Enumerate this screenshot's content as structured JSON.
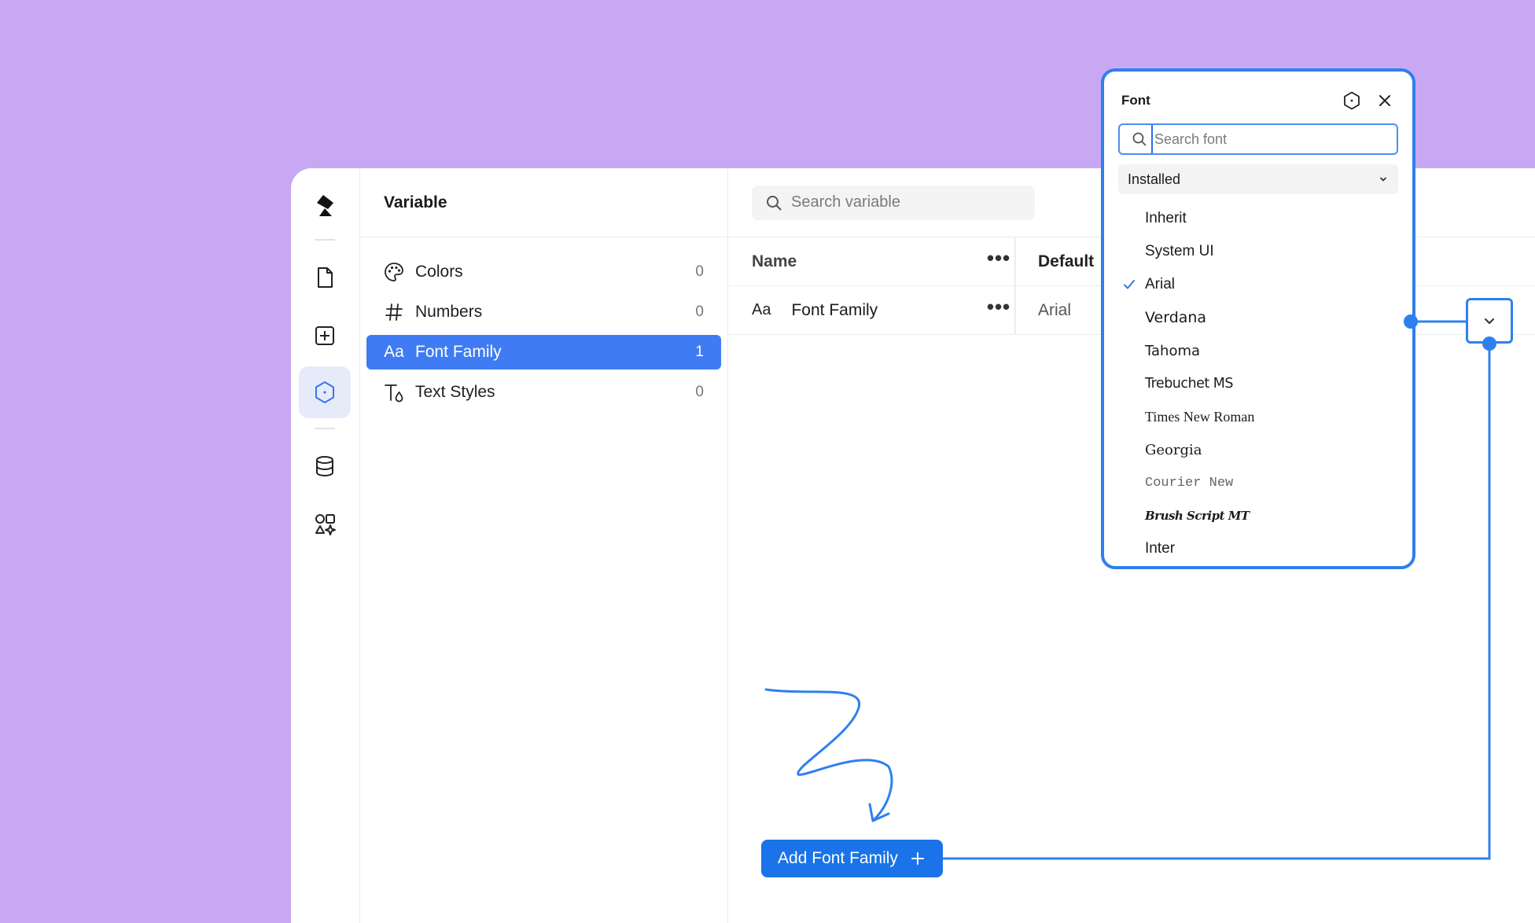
{
  "sidebar": {
    "icons": [
      "logo-icon",
      "page-icon",
      "add-square-icon",
      "variable-hex-icon",
      "database-icon",
      "components-icon"
    ]
  },
  "panel": {
    "title": "Variable",
    "categories": [
      {
        "label": "Colors",
        "count": "0",
        "icon": "palette-icon"
      },
      {
        "label": "Numbers",
        "count": "0",
        "icon": "hash-icon"
      },
      {
        "label": "Font Family",
        "count": "1",
        "icon": "font-aa-icon"
      },
      {
        "label": "Text Styles",
        "count": "0",
        "icon": "text-style-icon"
      }
    ]
  },
  "search": {
    "placeholder": "Search variable"
  },
  "table": {
    "headers": {
      "name": "Name",
      "default": "Default"
    },
    "rows": [
      {
        "icon_text": "Aa",
        "name": "Font Family",
        "default": "Arial"
      }
    ]
  },
  "popover": {
    "title": "Font",
    "search_placeholder": "Search font",
    "source": "Installed",
    "fonts": [
      "Inherit",
      "System UI",
      "Arial",
      "Verdana",
      "Tahoma",
      "Trebuchet MS",
      "Times New Roman",
      "Georgia",
      "Courier New",
      "Brush Script MT",
      "Inter"
    ],
    "selected": "Arial"
  },
  "add_button": {
    "label": "Add Font Family"
  },
  "colors": {
    "background": "#c8a8f2",
    "accent": "#3f7bf2",
    "annotation": "#2f80ed"
  }
}
